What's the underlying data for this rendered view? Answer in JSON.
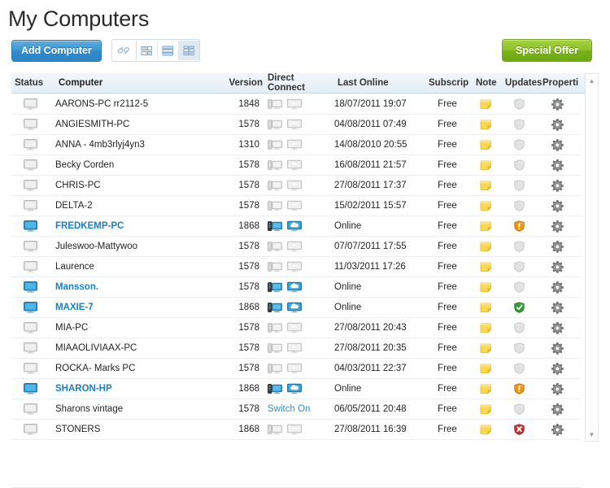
{
  "header": {
    "title": "My Computers",
    "add_button": "Add Computer",
    "special_offer": "Special Offer",
    "view_icons": [
      "link-icon",
      "view-tiles-icon",
      "view-list-icon",
      "view-compact-icon"
    ]
  },
  "table": {
    "columns": {
      "status": "Status",
      "computer": "Computer",
      "version": "Version",
      "direct_connect": "Direct Connect",
      "last_online": "Last Online",
      "subscription": "Subscrip",
      "note": "Note",
      "updates": "Updates",
      "properties": "Properti"
    },
    "switch_on_label": "Switch On",
    "rows": [
      {
        "name": "AARONS-PC rr2112-5",
        "version": "1848",
        "last_online": "18/07/2011 19:07",
        "subscription": "Free",
        "online": false,
        "updates": "none",
        "direct_connect": "icons"
      },
      {
        "name": "ANGIESMITH-PC",
        "version": "1578",
        "last_online": "04/08/2011 07:49",
        "subscription": "Free",
        "online": false,
        "updates": "none",
        "direct_connect": "icons"
      },
      {
        "name": "ANNA - 4mb3rlyj4yn3",
        "version": "1310",
        "last_online": "14/08/2010 20:55",
        "subscription": "Free",
        "online": false,
        "updates": "none",
        "direct_connect": "icons"
      },
      {
        "name": "Becky Corden",
        "version": "1578",
        "last_online": "16/08/2011 21:57",
        "subscription": "Free",
        "online": false,
        "updates": "none",
        "direct_connect": "icons"
      },
      {
        "name": "CHRIS-PC",
        "version": "1578",
        "last_online": "27/08/2011 17:37",
        "subscription": "Free",
        "online": false,
        "updates": "none",
        "direct_connect": "icons"
      },
      {
        "name": "DELTA-2",
        "version": "1578",
        "last_online": "15/02/2011 15:57",
        "subscription": "Free",
        "online": false,
        "updates": "none",
        "direct_connect": "icons"
      },
      {
        "name": "FREDKEMP-PC",
        "version": "1868",
        "last_online": "Online",
        "subscription": "Free",
        "online": true,
        "updates": "warning",
        "direct_connect": "icons"
      },
      {
        "name": "Juleswoo-Mattywoo",
        "version": "1578",
        "last_online": "07/07/2011 17:55",
        "subscription": "Free",
        "online": false,
        "updates": "none",
        "direct_connect": "icons"
      },
      {
        "name": "Laurence",
        "version": "1578",
        "last_online": "11/03/2011 17:26",
        "subscription": "Free",
        "online": false,
        "updates": "none",
        "direct_connect": "icons"
      },
      {
        "name": "Mansson.",
        "version": "1578",
        "last_online": "Online",
        "subscription": "Free",
        "online": true,
        "updates": "none",
        "direct_connect": "icons"
      },
      {
        "name": "MAXIE-7",
        "version": "1868",
        "last_online": "Online",
        "subscription": "Free",
        "online": true,
        "updates": "ok",
        "direct_connect": "icons"
      },
      {
        "name": "MIA-PC",
        "version": "1578",
        "last_online": "27/08/2011 20:43",
        "subscription": "Free",
        "online": false,
        "updates": "none",
        "direct_connect": "icons"
      },
      {
        "name": "MIAAOLIVIAAX-PC",
        "version": "1578",
        "last_online": "27/08/2011 20:35",
        "subscription": "Free",
        "online": false,
        "updates": "none",
        "direct_connect": "icons"
      },
      {
        "name": "ROCKA- Marks PC",
        "version": "1578",
        "last_online": "04/03/2011 22:37",
        "subscription": "Free",
        "online": false,
        "updates": "none",
        "direct_connect": "icons"
      },
      {
        "name": "SHARON-HP",
        "version": "1868",
        "last_online": "Online",
        "subscription": "Free",
        "online": true,
        "updates": "warning",
        "direct_connect": "icons"
      },
      {
        "name": "Sharons vintage",
        "version": "1578",
        "last_online": "06/05/2011 20:48",
        "subscription": "Free",
        "online": false,
        "updates": "none",
        "direct_connect": "switch_on"
      },
      {
        "name": "STONERS",
        "version": "1868",
        "last_online": "27/08/2011 16:39",
        "subscription": "Free",
        "online": false,
        "updates": "error",
        "direct_connect": "icons"
      }
    ]
  },
  "colors": {
    "accent_blue": "#2b8fd0",
    "online_text": "#1a7fc1",
    "offer_green": "#78b216",
    "note_yellow": "#f5cd3a",
    "shield_ok": "#2a9c2a",
    "shield_warning": "#e8900c",
    "shield_error": "#cc2a2a",
    "header_bg": "#e3edf5"
  },
  "scrollbar": {
    "up": "▲",
    "down": "▼"
  }
}
